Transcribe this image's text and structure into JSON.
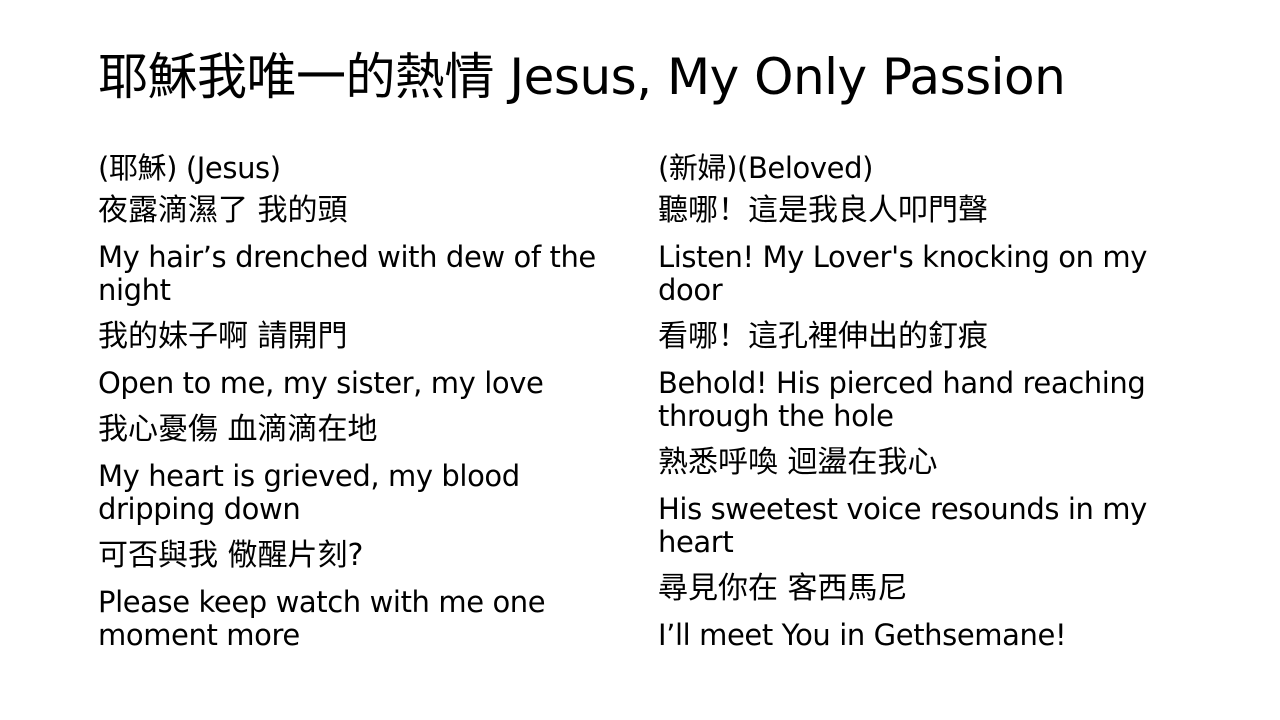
{
  "slide": {
    "title": "耶穌我唯一的熱情 Jesus, My Only Passion",
    "left": {
      "heading": "(耶穌) (Jesus)",
      "lines": [
        "夜露滴濕了 我的頭",
        "My hair’s drenched with dew of the night",
        "我的妹子啊 請開門",
        "Open to me, my sister, my love",
        "我心憂傷 血滴滴在地",
        "My heart is grieved, my blood dripping down",
        "可否與我 儆醒片刻?",
        "Please keep watch with me one moment more"
      ]
    },
    "right": {
      "heading": "(新婦)(Beloved)",
      "lines": [
        "聽哪！這是我良人叩門聲",
        "Listen! My Lover's knocking on my door",
        "看哪！這孔裡伸出的釘痕",
        "Behold! His pierced hand reaching through the hole",
        "熟悉呼喚 迴盪在我心",
        "His sweetest voice resounds in my heart",
        "尋見你在 客西馬尼",
        "I’ll meet You in Gethsemane!"
      ]
    }
  }
}
